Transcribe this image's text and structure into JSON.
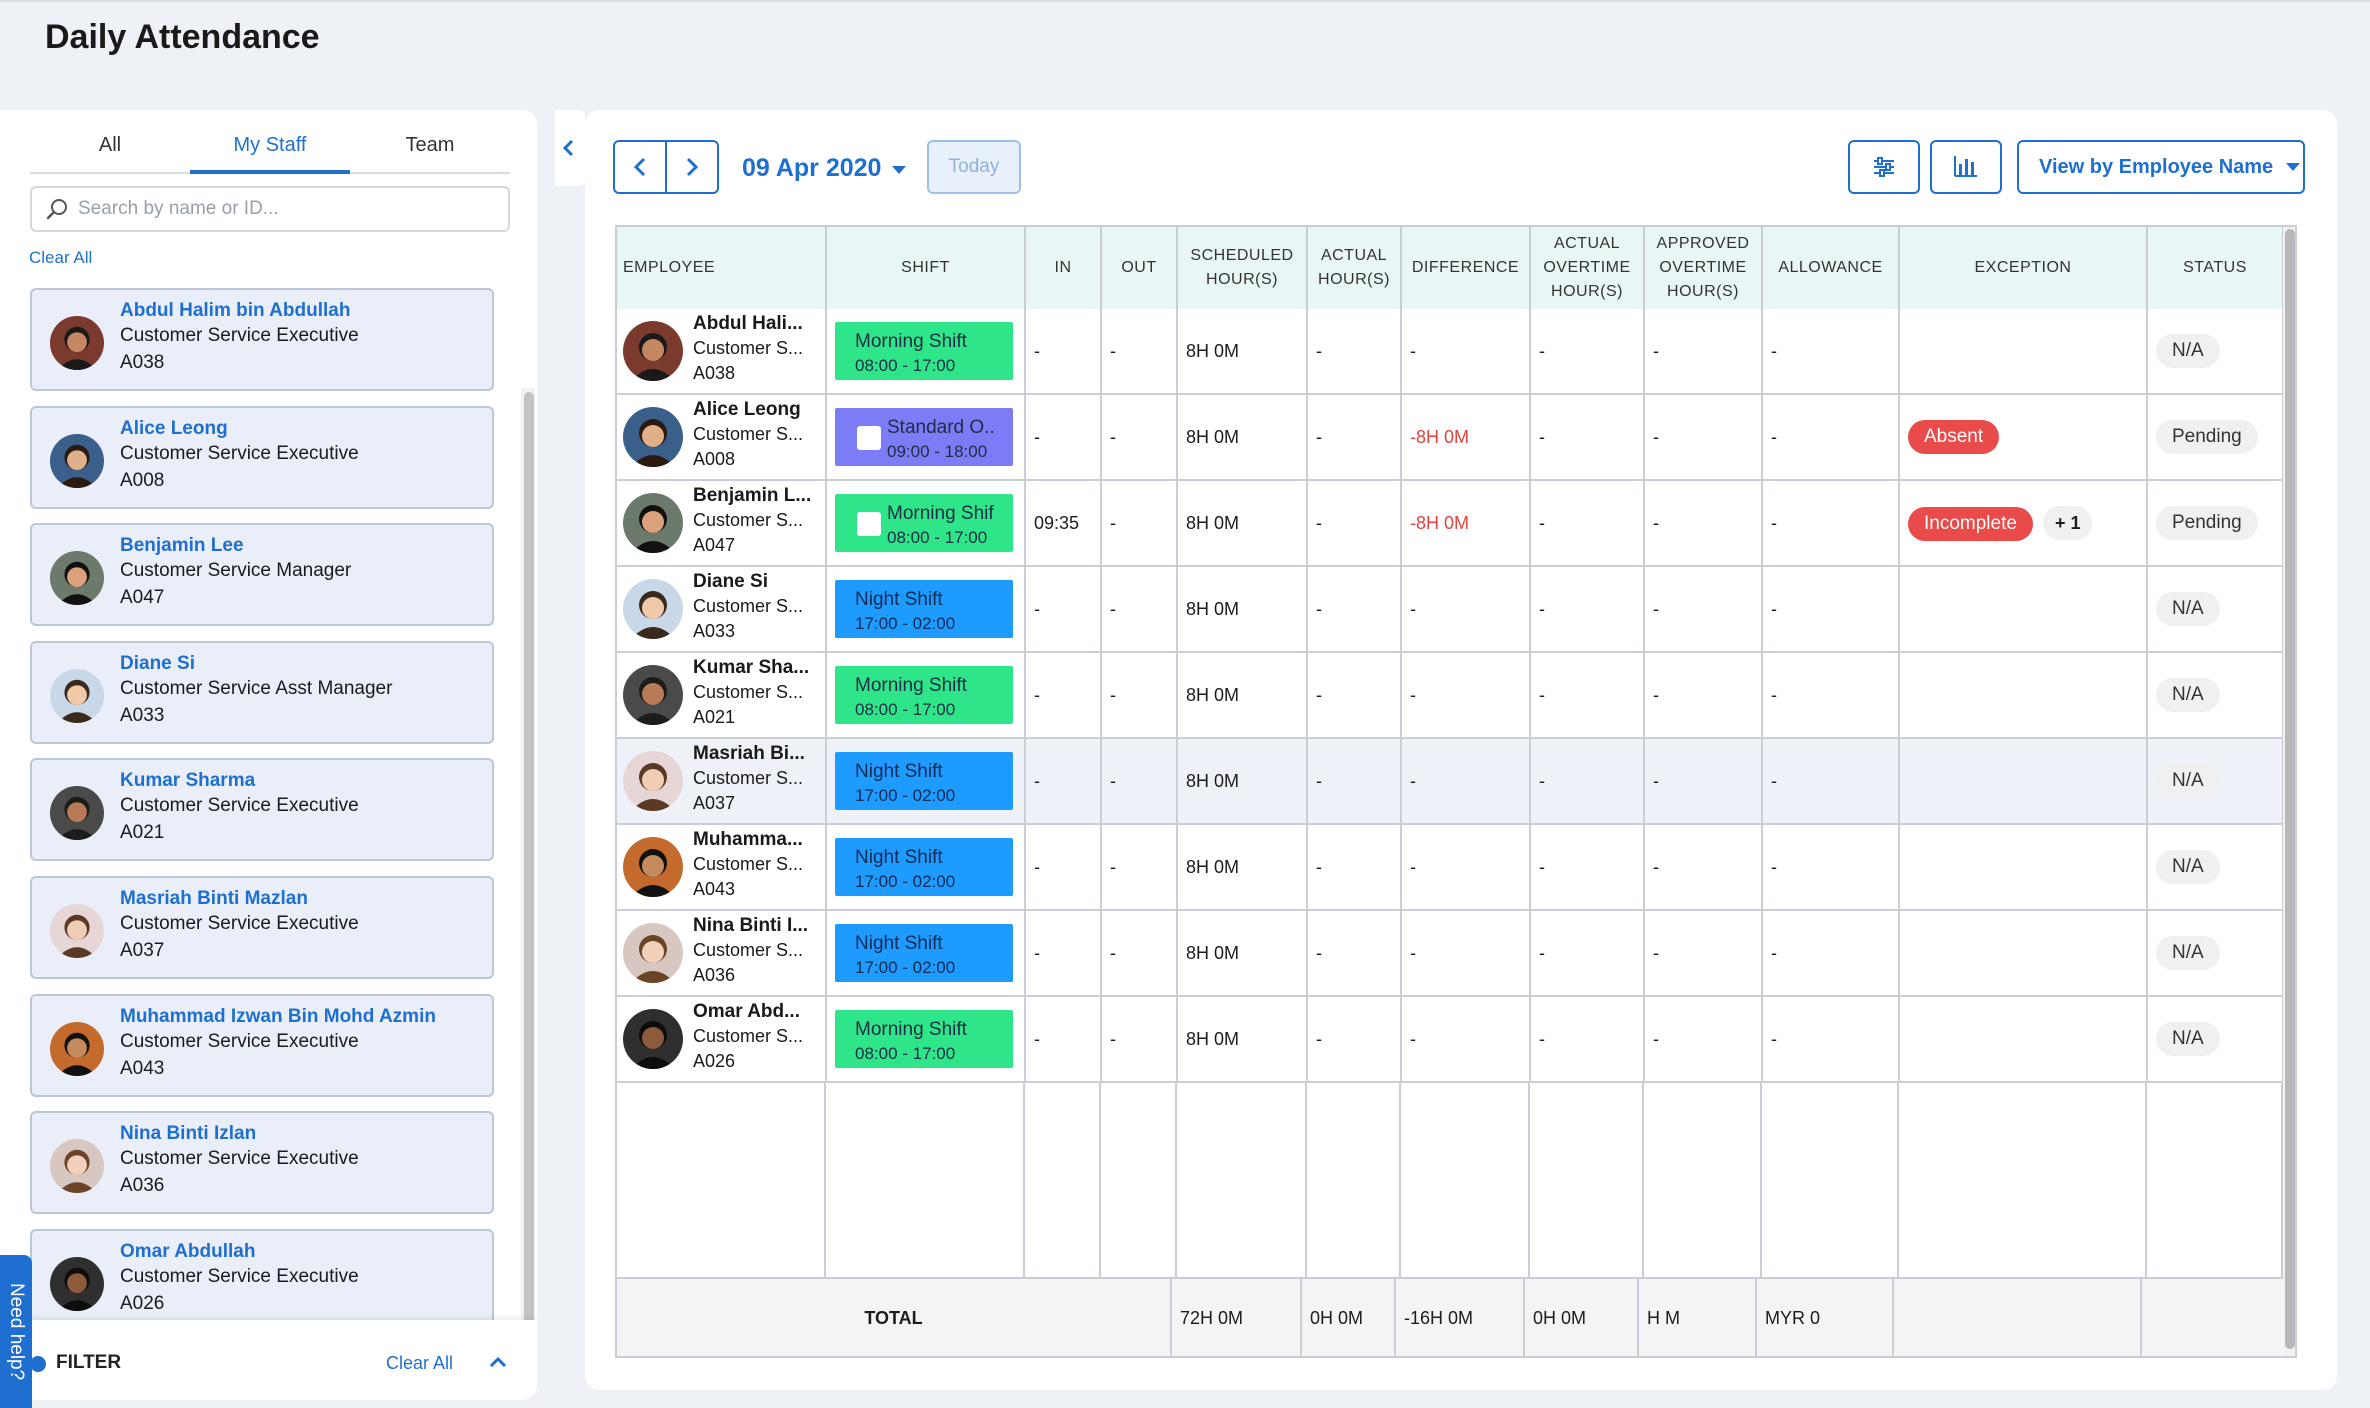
{
  "page": {
    "title": "Daily Attendance"
  },
  "left_panel": {
    "tabs": [
      {
        "label": "All",
        "active": false
      },
      {
        "label": "My Staff",
        "active": true
      },
      {
        "label": "Team",
        "active": false
      }
    ],
    "search": {
      "placeholder": "Search by name or ID...",
      "value": ""
    },
    "clear_all": "Clear All",
    "staff": [
      {
        "name": "Abdul Halim bin Abdullah",
        "role": "Customer Service Executive",
        "id": "A038"
      },
      {
        "name": "Alice Leong",
        "role": "Customer Service Executive",
        "id": "A008"
      },
      {
        "name": "Benjamin Lee",
        "role": "Customer Service Manager",
        "id": "A047"
      },
      {
        "name": "Diane Si",
        "role": "Customer Service Asst Manager",
        "id": "A033"
      },
      {
        "name": "Kumar Sharma",
        "role": "Customer Service Executive",
        "id": "A021"
      },
      {
        "name": "Masriah Binti Mazlan",
        "role": "Customer Service Executive",
        "id": "A037"
      },
      {
        "name": "Muhammad Izwan Bin Mohd Azmin",
        "role": "Customer Service Executive",
        "id": "A043"
      },
      {
        "name": "Nina Binti Izlan",
        "role": "Customer Service Executive",
        "id": "A036"
      },
      {
        "name": "Omar Abdullah",
        "role": "Customer Service Executive",
        "id": "A026"
      }
    ],
    "filter": {
      "label": "FILTER",
      "clear": "Clear All"
    }
  },
  "need_help": "Need help?",
  "toolbar": {
    "date": "09 Apr 2020",
    "today": "Today",
    "view_by": "View by Employee Name",
    "accent": "#1f6fd0"
  },
  "table": {
    "headers": {
      "employee": "EMPLOYEE",
      "shift": "SHIFT",
      "in": "IN",
      "out": "OUT",
      "scheduled_1": "SCHEDULED",
      "scheduled_2": "HOUR(S)",
      "actual_1": "ACTUAL",
      "actual_2": "HOUR(S)",
      "difference": "DIFFERENCE",
      "actual_ot_1": "ACTUAL",
      "actual_ot_2": "OVERTIME",
      "actual_ot_3": "HOUR(S)",
      "approved_ot_1": "APPROVED",
      "approved_ot_2": "OVERTIME",
      "approved_ot_3": "HOUR(S)",
      "allowance": "ALLOWANCE",
      "exception": "EXCEPTION",
      "status": "STATUS"
    },
    "rows": [
      {
        "name": "Abdul Hali...",
        "role": "Customer S...",
        "id": "A038",
        "shift_name": "Morning Shift",
        "shift_time": "08:00 - 17:00",
        "shift_type": "morning",
        "checkbox": false,
        "in": "-",
        "out": "-",
        "scheduled": "8H 0M",
        "actual": "-",
        "difference": "-",
        "actual_ot": "-",
        "approved_ot": "-",
        "allowance": "-",
        "exception": "",
        "exception_extra": "",
        "status": "N/A"
      },
      {
        "name": "Alice Leong",
        "role": "Customer S...",
        "id": "A008",
        "shift_name": "Standard O..",
        "shift_time": "09:00 - 18:00",
        "shift_type": "standard",
        "checkbox": true,
        "in": "-",
        "out": "-",
        "scheduled": "8H 0M",
        "actual": "-",
        "difference": "-8H 0M",
        "actual_ot": "-",
        "approved_ot": "-",
        "allowance": "-",
        "exception": "Absent",
        "exception_extra": "",
        "status": "Pending"
      },
      {
        "name": "Benjamin L...",
        "role": "Customer S...",
        "id": "A047",
        "shift_name": "Morning Shif",
        "shift_time": "08:00 - 17:00",
        "shift_type": "morning",
        "checkbox": true,
        "in": "09:35",
        "out": "-",
        "scheduled": "8H 0M",
        "actual": "-",
        "difference": "-8H 0M",
        "actual_ot": "-",
        "approved_ot": "-",
        "allowance": "-",
        "exception": "Incomplete",
        "exception_extra": "+ 1",
        "status": "Pending"
      },
      {
        "name": "Diane Si",
        "role": "Customer S...",
        "id": "A033",
        "shift_name": "Night Shift",
        "shift_time": "17:00 - 02:00",
        "shift_type": "night",
        "checkbox": false,
        "in": "-",
        "out": "-",
        "scheduled": "8H 0M",
        "actual": "-",
        "difference": "-",
        "actual_ot": "-",
        "approved_ot": "-",
        "allowance": "-",
        "exception": "",
        "exception_extra": "",
        "status": "N/A"
      },
      {
        "name": "Kumar Sha...",
        "role": "Customer S...",
        "id": "A021",
        "shift_name": "Morning Shift",
        "shift_time": "08:00 - 17:00",
        "shift_type": "morning",
        "checkbox": false,
        "in": "-",
        "out": "-",
        "scheduled": "8H 0M",
        "actual": "-",
        "difference": "-",
        "actual_ot": "-",
        "approved_ot": "-",
        "allowance": "-",
        "exception": "",
        "exception_extra": "",
        "status": "N/A"
      },
      {
        "name": "Masriah Bi...",
        "role": "Customer S...",
        "id": "A037",
        "shift_name": "Night Shift",
        "shift_time": "17:00 - 02:00",
        "shift_type": "night",
        "checkbox": false,
        "in": "-",
        "out": "-",
        "scheduled": "8H 0M",
        "actual": "-",
        "difference": "-",
        "actual_ot": "-",
        "approved_ot": "-",
        "allowance": "-",
        "exception": "",
        "exception_extra": "",
        "status": "N/A"
      },
      {
        "name": "Muhamma...",
        "role": "Customer S...",
        "id": "A043",
        "shift_name": "Night Shift",
        "shift_time": "17:00 - 02:00",
        "shift_type": "night",
        "checkbox": false,
        "in": "-",
        "out": "-",
        "scheduled": "8H 0M",
        "actual": "-",
        "difference": "-",
        "actual_ot": "-",
        "approved_ot": "-",
        "allowance": "-",
        "exception": "",
        "exception_extra": "",
        "status": "N/A"
      },
      {
        "name": "Nina Binti I...",
        "role": "Customer S...",
        "id": "A036",
        "shift_name": "Night Shift",
        "shift_time": "17:00 - 02:00",
        "shift_type": "night",
        "checkbox": false,
        "in": "-",
        "out": "-",
        "scheduled": "8H 0M",
        "actual": "-",
        "difference": "-",
        "actual_ot": "-",
        "approved_ot": "-",
        "allowance": "-",
        "exception": "",
        "exception_extra": "",
        "status": "N/A"
      },
      {
        "name": "Omar Abd...",
        "role": "Customer S...",
        "id": "A026",
        "shift_name": "Morning Shift",
        "shift_time": "08:00 - 17:00",
        "shift_type": "morning",
        "checkbox": false,
        "in": "-",
        "out": "-",
        "scheduled": "8H 0M",
        "actual": "-",
        "difference": "-",
        "actual_ot": "-",
        "approved_ot": "-",
        "allowance": "-",
        "exception": "",
        "exception_extra": "",
        "status": "N/A"
      }
    ],
    "totals": {
      "label": "TOTAL",
      "scheduled": "72H 0M",
      "actual": "0H 0M",
      "difference": "-16H 0M",
      "actual_ot": "0H 0M",
      "approved_ot": "H M",
      "allowance": "MYR 0"
    }
  },
  "colors": {
    "morning": "#2ee689",
    "night": "#1e9bff",
    "standard": "#7c7cf7",
    "exception": "#e94a4a",
    "negative": "#e0433f"
  }
}
